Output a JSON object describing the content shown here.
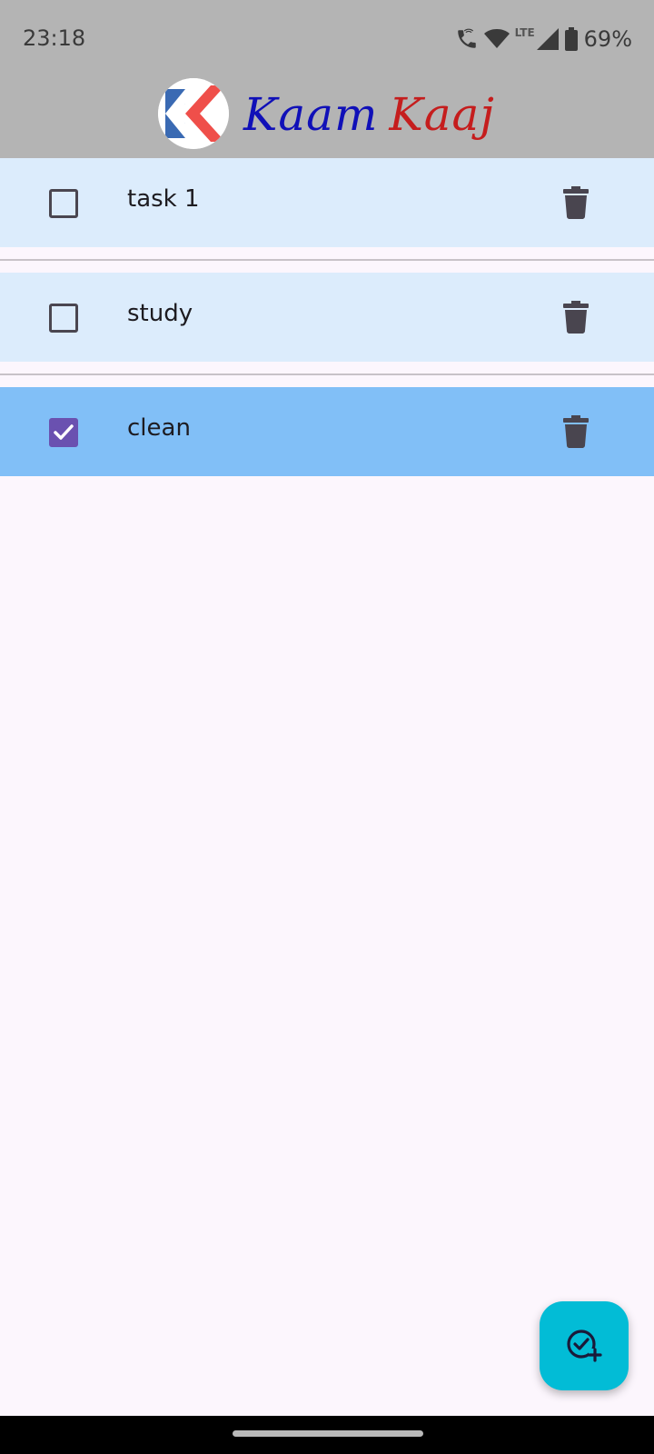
{
  "status_bar": {
    "time": "23:18",
    "network_label": "LTE",
    "battery": "69%",
    "icons": [
      "wifi-call-icon",
      "wifi-icon",
      "signal-icon",
      "battery-icon"
    ]
  },
  "app_bar": {
    "title_part1": "Kaam",
    "title_part2": "Kaaj",
    "logo_letter": "K",
    "colors": {
      "title_part1": "#1010b8",
      "title_part2": "#c51d1d",
      "logo_red": "#ef4f4a",
      "logo_blue": "#3a6ab3"
    }
  },
  "tasks": [
    {
      "label": "task 1",
      "checked": false
    },
    {
      "label": "study",
      "checked": false
    },
    {
      "label": "clean",
      "checked": true
    }
  ],
  "fab": {
    "icon": "add-task-icon"
  },
  "colors": {
    "header_bg": "#b4b4b4",
    "row_bg": "#dcecfc",
    "row_checked_bg": "#81bff7",
    "checkbox_checked": "#6a51b0",
    "fab_bg": "#02bcd6",
    "page_bg": "#fcf6fd"
  }
}
